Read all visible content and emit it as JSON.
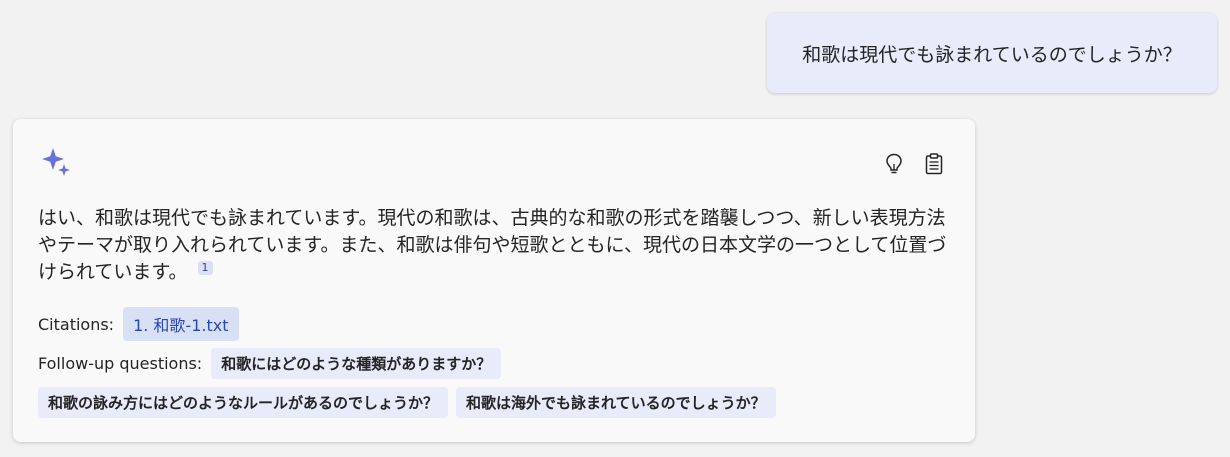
{
  "user_message": {
    "text": "和歌は現代でも詠まれているのでしょうか？"
  },
  "answer": {
    "icon": "sparkle-icon",
    "actions": [
      {
        "icon": "lightbulb-icon"
      },
      {
        "icon": "clipboard-icon"
      }
    ],
    "text": "はい、和歌は現代でも詠まれています。現代の和歌は、古典的な和歌の形式を踏襲しつつ、新しい表現方法やテーマが取り入れられています。また、和歌は俳句や短歌とともに、現代の日本文学の一つとして位置づけられています。",
    "citation_marker": "1",
    "citations_label": "Citations:",
    "citations": [
      "1. 和歌-1.txt"
    ],
    "followup_label": "Follow-up questions:",
    "followups": [
      "和歌にはどのような種類がありますか？",
      "和歌の詠み方にはどのようなルールがあるのでしょうか？",
      "和歌は海外でも詠まれているのでしょうか？"
    ]
  },
  "colors": {
    "background": "#f2f2f2",
    "user_bubble": "#e8ebfa",
    "card": "#f9f9f9",
    "accent": "#6b72d6",
    "citation_chip": "#d8e0f6",
    "citation_text": "#2a46b0"
  }
}
